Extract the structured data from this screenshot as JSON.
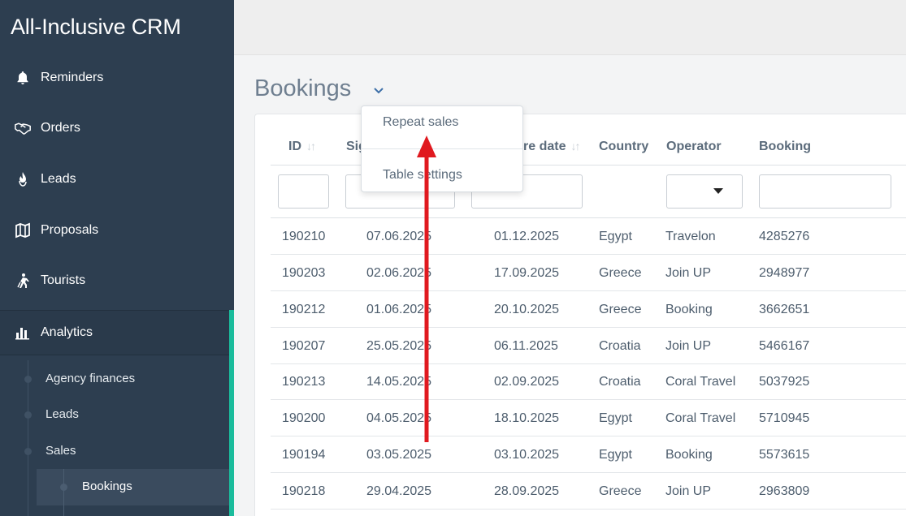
{
  "app": {
    "title": "All-Inclusive CRM"
  },
  "sidebar": {
    "items": [
      {
        "label": "Reminders",
        "icon": "bell-icon"
      },
      {
        "label": "Orders",
        "icon": "handshake-icon"
      },
      {
        "label": "Leads",
        "icon": "flame-icon"
      },
      {
        "label": "Proposals",
        "icon": "map-icon"
      },
      {
        "label": "Tourists",
        "icon": "traveler-icon"
      },
      {
        "label": "Analytics",
        "icon": "bar-chart-icon"
      }
    ],
    "sub_items": [
      {
        "label": "Agency finances"
      },
      {
        "label": "Leads"
      },
      {
        "label": "Sales"
      }
    ],
    "selected_sub": {
      "label": "Bookings"
    },
    "accent_color": "#1abc9c"
  },
  "page": {
    "title": "Bookings"
  },
  "dropdown": {
    "items": [
      {
        "label": "Repeat sales"
      },
      {
        "label": "Table settings"
      }
    ]
  },
  "table": {
    "columns": [
      {
        "label": "ID"
      },
      {
        "label": "Sig"
      },
      {
        "label": "re date"
      },
      {
        "label": "Country"
      },
      {
        "label": "Operator"
      },
      {
        "label": "Booking"
      }
    ],
    "rows": [
      {
        "id": "190210",
        "signed": "07.06.2025",
        "departure": "01.12.2025",
        "country": "Egypt",
        "operator": "Travelon",
        "booking": "4285276"
      },
      {
        "id": "190203",
        "signed": "02.06.2025",
        "departure": "17.09.2025",
        "country": "Greece",
        "operator": "Join UP",
        "booking": "2948977"
      },
      {
        "id": "190212",
        "signed": "01.06.2025",
        "departure": "20.10.2025",
        "country": "Greece",
        "operator": "Booking",
        "booking": "3662651"
      },
      {
        "id": "190207",
        "signed": "25.05.2025",
        "departure": "06.11.2025",
        "country": "Croatia",
        "operator": "Join UP",
        "booking": "5466167"
      },
      {
        "id": "190213",
        "signed": "14.05.2025",
        "departure": "02.09.2025",
        "country": "Croatia",
        "operator": "Coral Travel",
        "booking": "5037925"
      },
      {
        "id": "190200",
        "signed": "04.05.2025",
        "departure": "18.10.2025",
        "country": "Egypt",
        "operator": "Coral Travel",
        "booking": "5710945"
      },
      {
        "id": "190194",
        "signed": "03.05.2025",
        "departure": "03.10.2025",
        "country": "Egypt",
        "operator": "Booking",
        "booking": "5573615"
      },
      {
        "id": "190218",
        "signed": "29.04.2025",
        "departure": "28.09.2025",
        "country": "Greece",
        "operator": "Join UP",
        "booking": "2963809"
      }
    ]
  },
  "annotation": {
    "arrow_color": "#e0191f"
  }
}
